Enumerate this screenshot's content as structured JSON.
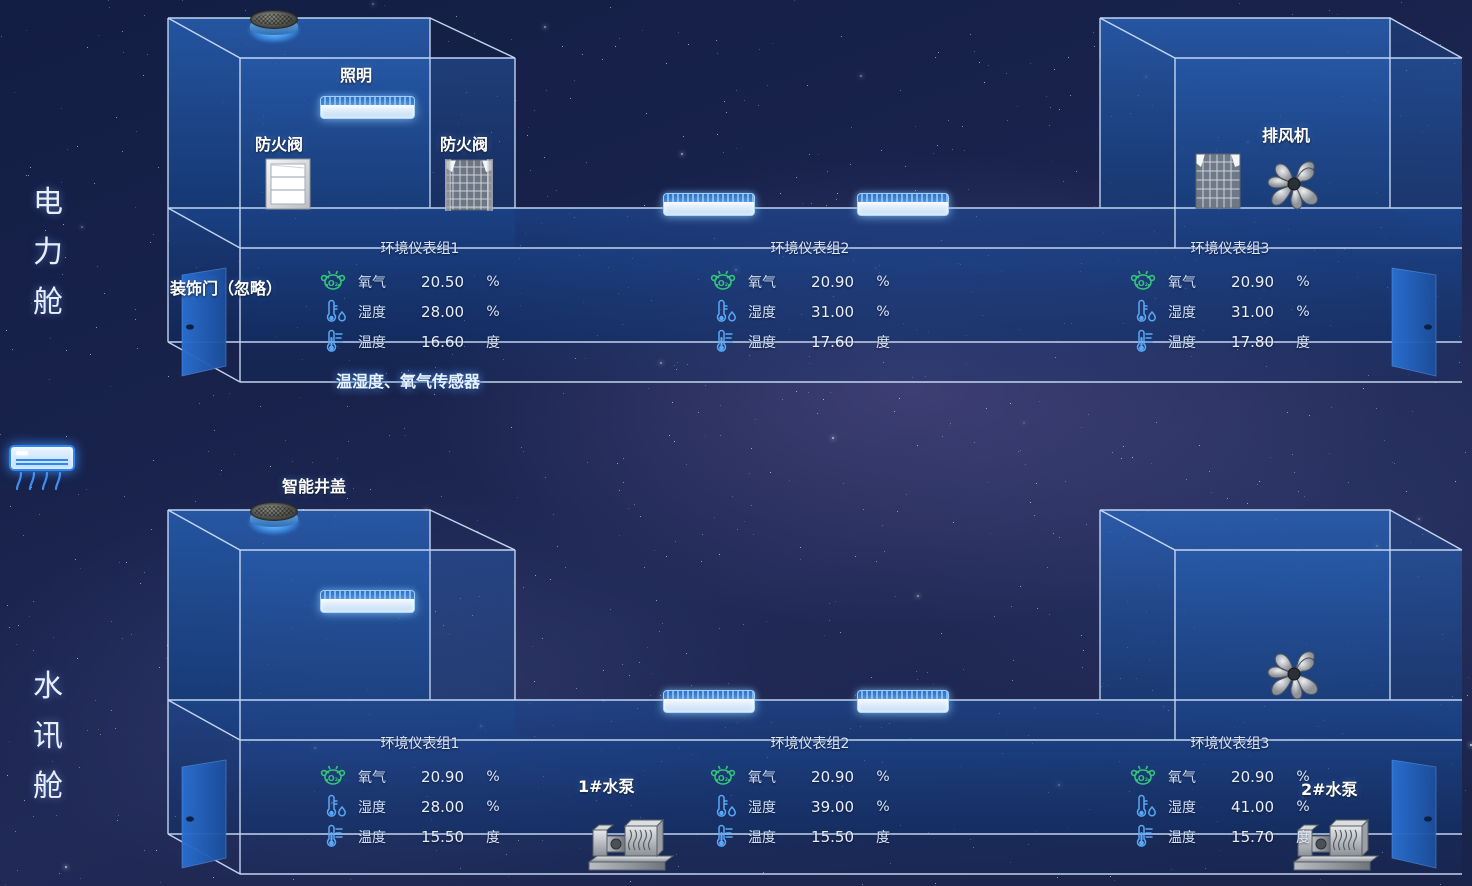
{
  "sections": [
    {
      "id": "power",
      "vertical_label": "电力舱",
      "vertical_chars": [
        "电",
        "力",
        "舱"
      ],
      "equipment_labels": {
        "lighting": "照明",
        "fire_damper_left": "防火阀",
        "fire_damper_right": "防火阀",
        "exhaust_fan": "排风机",
        "decor_door": "装饰门（忽略）",
        "sensor_caption": "温湿度、氧气传感器"
      },
      "meter_groups": [
        {
          "title": "环境仪表组1",
          "rows": [
            {
              "icon": "oxygen-icon",
              "name": "氧气",
              "value": "20.50",
              "unit": "%"
            },
            {
              "icon": "humidity-icon",
              "name": "湿度",
              "value": "28.00",
              "unit": "%"
            },
            {
              "icon": "temperature-icon",
              "name": "温度",
              "value": "16.60",
              "unit": "度"
            }
          ]
        },
        {
          "title": "环境仪表组2",
          "rows": [
            {
              "icon": "oxygen-icon",
              "name": "氧气",
              "value": "20.90",
              "unit": "%"
            },
            {
              "icon": "humidity-icon",
              "name": "湿度",
              "value": "31.00",
              "unit": "%"
            },
            {
              "icon": "temperature-icon",
              "name": "温度",
              "value": "17.60",
              "unit": "度"
            }
          ]
        },
        {
          "title": "环境仪表组3",
          "rows": [
            {
              "icon": "oxygen-icon",
              "name": "氧气",
              "value": "20.90",
              "unit": "%"
            },
            {
              "icon": "humidity-icon",
              "name": "湿度",
              "value": "31.00",
              "unit": "%"
            },
            {
              "icon": "temperature-icon",
              "name": "温度",
              "value": "17.80",
              "unit": "度"
            }
          ]
        }
      ]
    },
    {
      "id": "water",
      "vertical_label": "水讯舱",
      "vertical_chars": [
        "水",
        "讯",
        "舱"
      ],
      "equipment_labels": {
        "manhole": "智能井盖",
        "pump_1": "1#水泵",
        "pump_2": "2#水泵"
      },
      "meter_groups": [
        {
          "title": "环境仪表组1",
          "rows": [
            {
              "icon": "oxygen-icon",
              "name": "氧气",
              "value": "20.90",
              "unit": "%"
            },
            {
              "icon": "humidity-icon",
              "name": "湿度",
              "value": "28.00",
              "unit": "%"
            },
            {
              "icon": "temperature-icon",
              "name": "温度",
              "value": "15.50",
              "unit": "度"
            }
          ]
        },
        {
          "title": "环境仪表组2",
          "rows": [
            {
              "icon": "oxygen-icon",
              "name": "氧气",
              "value": "20.90",
              "unit": "%"
            },
            {
              "icon": "humidity-icon",
              "name": "湿度",
              "value": "39.00",
              "unit": "%"
            },
            {
              "icon": "temperature-icon",
              "name": "温度",
              "value": "15.50",
              "unit": "度"
            }
          ]
        },
        {
          "title": "环境仪表组3",
          "rows": [
            {
              "icon": "oxygen-icon",
              "name": "氧气",
              "value": "20.90",
              "unit": "%"
            },
            {
              "icon": "humidity-icon",
              "name": "湿度",
              "value": "41.00",
              "unit": "%"
            },
            {
              "icon": "temperature-icon",
              "name": "温度",
              "value": "15.70",
              "unit": "度"
            }
          ]
        }
      ]
    }
  ],
  "colors": {
    "oxygen_icon": "#35c47a",
    "sensor_icon": "#5aa8f5",
    "tunnel_edge": "#cfe2fb",
    "tunnel_fill": "#1d52a8",
    "door": "#2f77d8",
    "background_deep": "#131e44",
    "label_text": "#ffffff"
  }
}
